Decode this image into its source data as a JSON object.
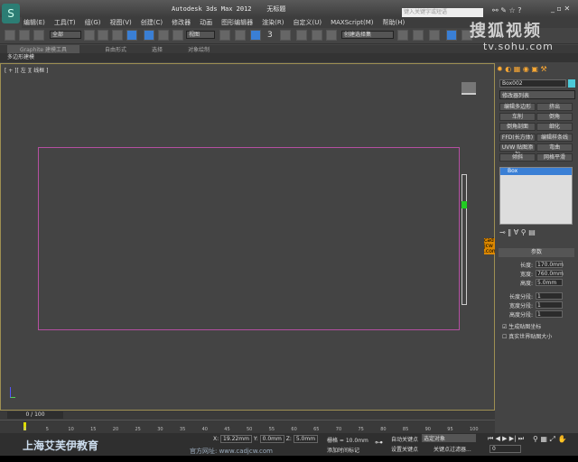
{
  "title": {
    "app": "Autodesk 3ds Max  2012",
    "doc": "无标题",
    "search_placeholder": "键入关键字或短语"
  },
  "menu": [
    "编辑(E)",
    "工具(T)",
    "组(G)",
    "视图(V)",
    "创建(C)",
    "修改器",
    "动画",
    "图形编辑器",
    "渲染(R)",
    "自定义(U)",
    "MAXScript(M)",
    "帮助(H)"
  ],
  "toolbar": {
    "selection_filter": "全部",
    "ref_coord": "视图",
    "named_selection": "创建选择集",
    "snap_label": "3"
  },
  "ribbon": {
    "tabs": [
      "Graphite 建模工具",
      "自由形式",
      "选择",
      "对象绘制"
    ],
    "sub": "多边形建模"
  },
  "viewport": {
    "label": "[ + ][ 左 ][ 线框 ]"
  },
  "panel": {
    "object_name": "Box002",
    "modifier_list": "修改器列表",
    "modifiers": [
      "编辑多边形",
      "挤出",
      "车削",
      "倒角",
      "倒角剖面",
      "细化",
      "FFD(长方体)",
      "编辑样条线",
      "UVW 贴图添加",
      "弯曲",
      "倾斜",
      "网格平滑"
    ],
    "stack_item": "Box",
    "rollout": "参数",
    "params": [
      {
        "label": "长度:",
        "value": "170.0mm"
      },
      {
        "label": "宽度:",
        "value": "760.0mm"
      },
      {
        "label": "高度:",
        "value": "5.0mm"
      },
      {
        "label": "长度分段:",
        "value": "1"
      },
      {
        "label": "宽度分段:",
        "value": "1"
      },
      {
        "label": "高度分段:",
        "value": "1"
      }
    ],
    "gen_map": "生成贴图坐标",
    "real_world": "真实世界贴图大小"
  },
  "timeline": {
    "frame": "0 / 100",
    "ticks": [
      "0",
      "5",
      "10",
      "15",
      "20",
      "25",
      "30",
      "35",
      "40",
      "45",
      "50",
      "55",
      "60",
      "65",
      "70",
      "75",
      "80",
      "85",
      "90",
      "95",
      "100"
    ]
  },
  "status": {
    "x": "19.22mm",
    "y": "0.0mm",
    "z": "5.0mm",
    "grid": "栅格 = 10.0mm",
    "auto_key": "自动关键点",
    "set_key": "设置关键点",
    "selected": "选定对象",
    "key_filters": "关键点过滤器...",
    "add_tag": "添加时间标记",
    "frame_field": "0"
  },
  "watermark": {
    "school": "上海艾芙伊教育",
    "site": "官方网址: www.cadjcw.com",
    "sohu": "搜狐视频",
    "sohu_url": "tv.sohu.com",
    "cad": "cad jcw .com"
  }
}
